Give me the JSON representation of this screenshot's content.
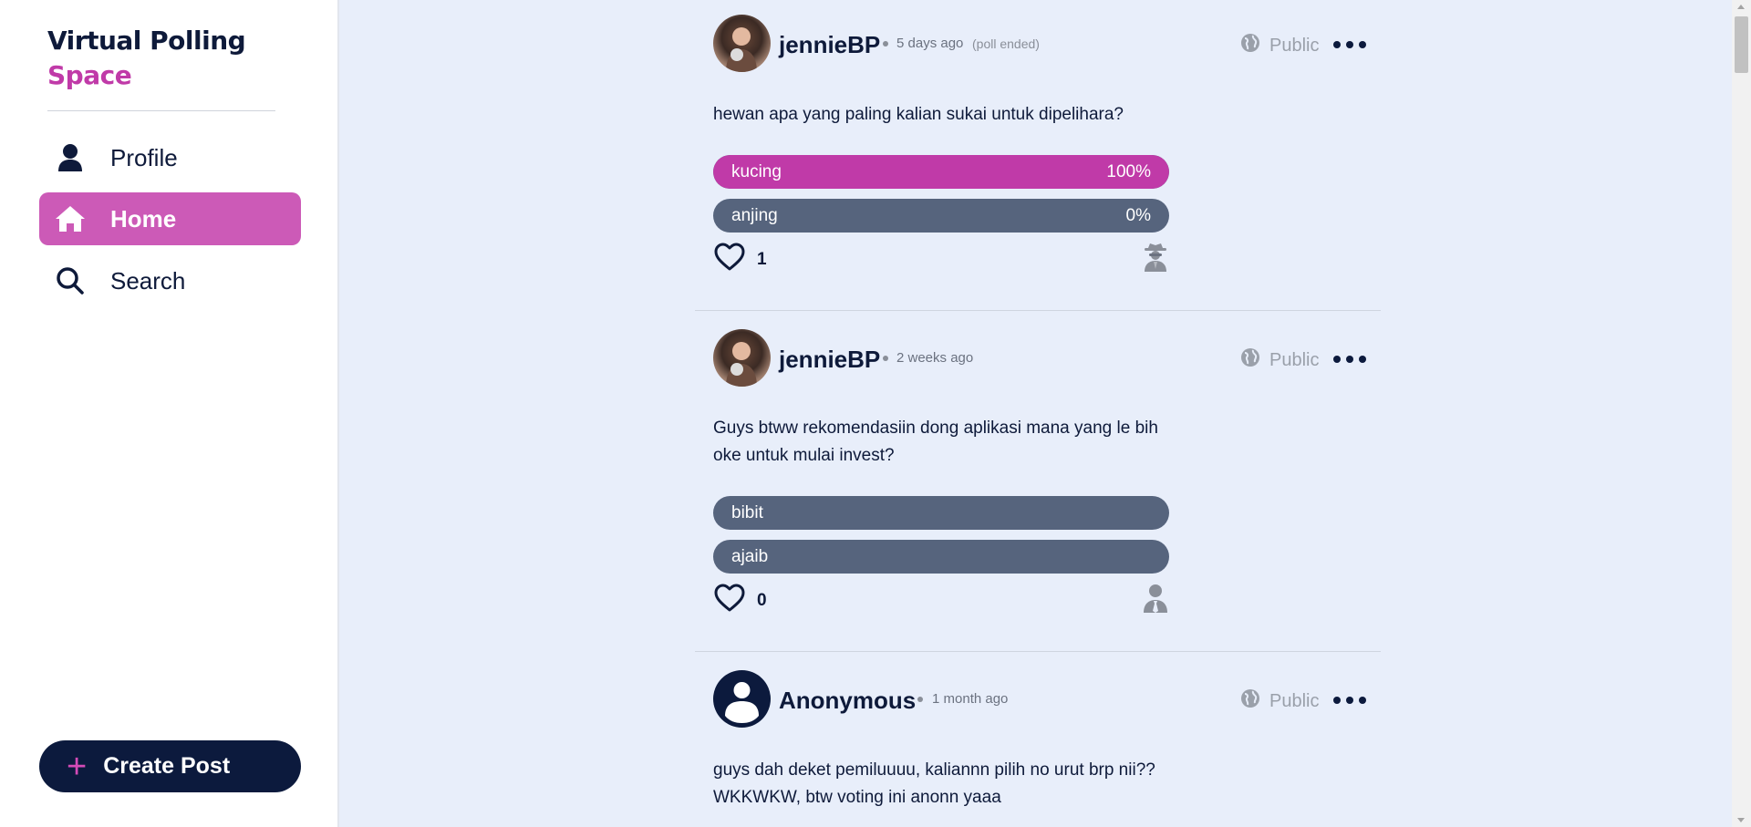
{
  "app": {
    "brand_line1": "Virtual Polling",
    "brand_line2": "Space"
  },
  "sidebar": {
    "items": [
      {
        "label": "Profile",
        "icon": "person-icon"
      },
      {
        "label": "Home",
        "icon": "home-icon",
        "active": true
      },
      {
        "label": "Search",
        "icon": "search-icon"
      }
    ],
    "create_post": {
      "label": "Create Post",
      "icon": "plus-icon"
    }
  },
  "colors": {
    "accent": "#c03aa8",
    "nav_active": "#cc5ab7",
    "navy": "#0c1a3d",
    "option_bg": "#56647d",
    "page_bg": "#e8eefa"
  },
  "posts": [
    {
      "username": "jennieBP",
      "time": "5 days ago",
      "status": "(poll ended)",
      "visibility": "Public",
      "question": "hewan apa yang paling kalian sukai untuk dipelihara?",
      "options": [
        {
          "label": "kucing",
          "percent": "100%",
          "fraction": 1.0
        },
        {
          "label": "anjing",
          "percent": "0%",
          "fraction": 0.0
        }
      ],
      "likes": "1",
      "voter_icon": "spy-icon"
    },
    {
      "username": "jennieBP",
      "time": "2 weeks ago",
      "visibility": "Public",
      "question": "Guys btww rekomendasiin dong aplikasi mana yang le bih oke untuk mulai invest?",
      "options": [
        {
          "label": "bibit"
        },
        {
          "label": "ajaib"
        }
      ],
      "likes": "0",
      "voter_icon": "user-tie-icon"
    },
    {
      "username": "Anonymous",
      "time": "1 month ago",
      "visibility": "Public",
      "question": "guys dah deket pemiluuuu, kaliannn pilih no urut brp nii?? WKKWKW, btw voting ini anonn yaaa"
    }
  ]
}
